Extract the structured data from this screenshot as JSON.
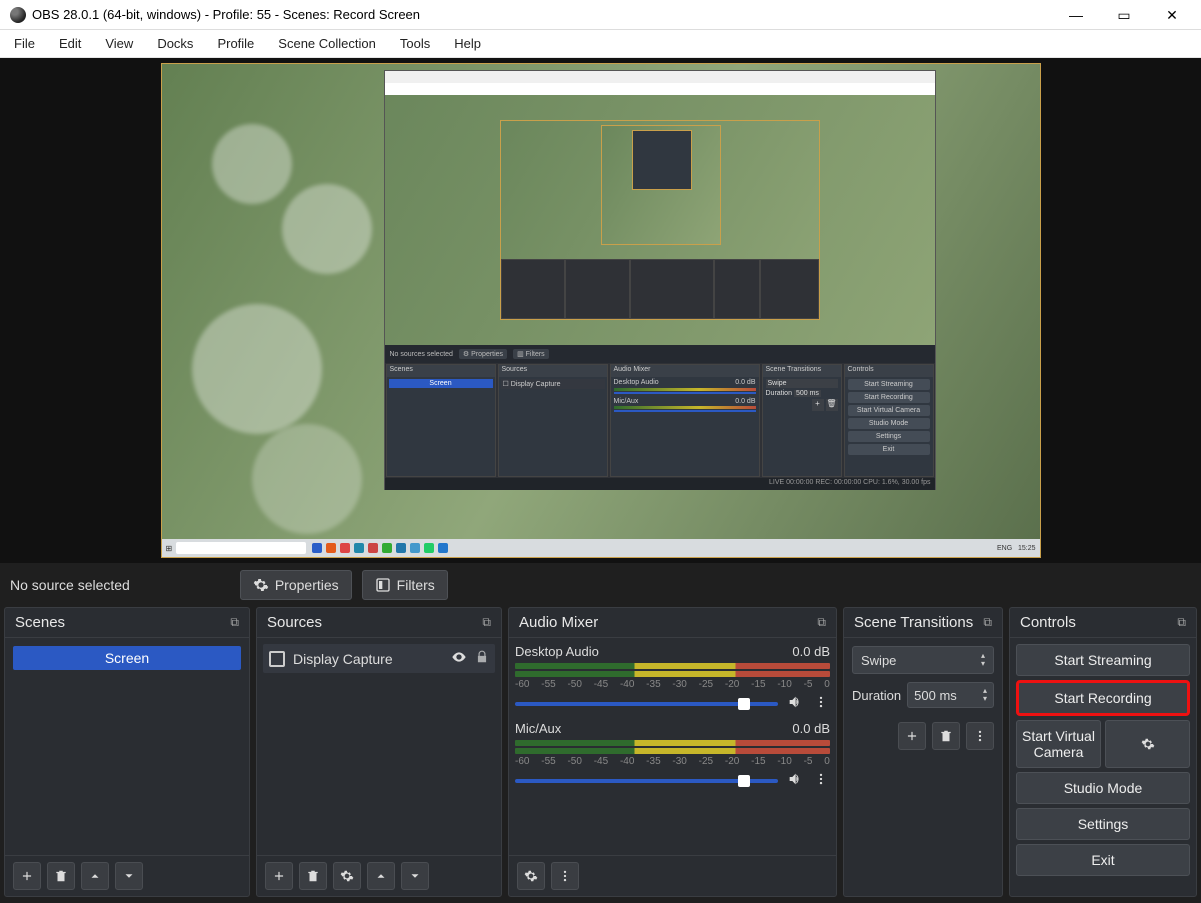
{
  "titlebar": {
    "title": "OBS 28.0.1 (64-bit, windows) - Profile: 55 - Scenes: Record Screen"
  },
  "menu": {
    "file": "File",
    "edit": "Edit",
    "view": "View",
    "docks": "Docks",
    "profile": "Profile",
    "scene_collection": "Scene Collection",
    "tools": "Tools",
    "help": "Help"
  },
  "source_bar": {
    "no_source": "No source selected",
    "properties": "Properties",
    "filters": "Filters"
  },
  "panels": {
    "scenes": "Scenes",
    "sources": "Sources",
    "audio": "Audio Mixer",
    "transitions": "Scene Transitions",
    "controls": "Controls"
  },
  "scenes": {
    "items": [
      "Screen"
    ]
  },
  "sources": {
    "items": [
      {
        "label": "Display Capture"
      }
    ]
  },
  "audio": {
    "channels": [
      {
        "name": "Desktop Audio",
        "level": "0.0 dB"
      },
      {
        "name": "Mic/Aux",
        "level": "0.0 dB"
      }
    ],
    "ticks": [
      "-60",
      "-55",
      "-50",
      "-45",
      "-40",
      "-35",
      "-30",
      "-25",
      "-20",
      "-15",
      "-10",
      "-5",
      "0"
    ]
  },
  "transitions": {
    "selected": "Swipe",
    "duration_label": "Duration",
    "duration_value": "500 ms"
  },
  "controls": {
    "start_streaming": "Start Streaming",
    "start_recording": "Start Recording",
    "start_virtual_camera": "Start Virtual Camera",
    "studio_mode": "Studio Mode",
    "settings": "Settings",
    "exit": "Exit"
  },
  "nested": {
    "no_source": "No sources selected",
    "properties": "Properties",
    "filters": "Filters",
    "scenes": "Scenes",
    "scene_item": "Screen",
    "sources": "Sources",
    "source_item": "Display Capture",
    "audio": "Audio Mixer",
    "desktop": "Desktop Audio",
    "desktop_db": "0.0 dB",
    "mic": "Mic/Aux",
    "mic_db": "0.0 dB",
    "transitions": "Scene Transitions",
    "swipe": "Swipe",
    "duration": "Duration",
    "durval": "500 ms",
    "controls": "Controls",
    "ctrl_stream": "Start Streaming",
    "ctrl_record": "Start Recording",
    "ctrl_virtual": "Start Virtual Camera",
    "ctrl_studio": "Studio Mode",
    "ctrl_settings": "Settings",
    "ctrl_exit": "Exit",
    "status": "LIVE 00:00:00   REC: 00:00:00   CPU: 1.6%, 30.00 fps"
  }
}
